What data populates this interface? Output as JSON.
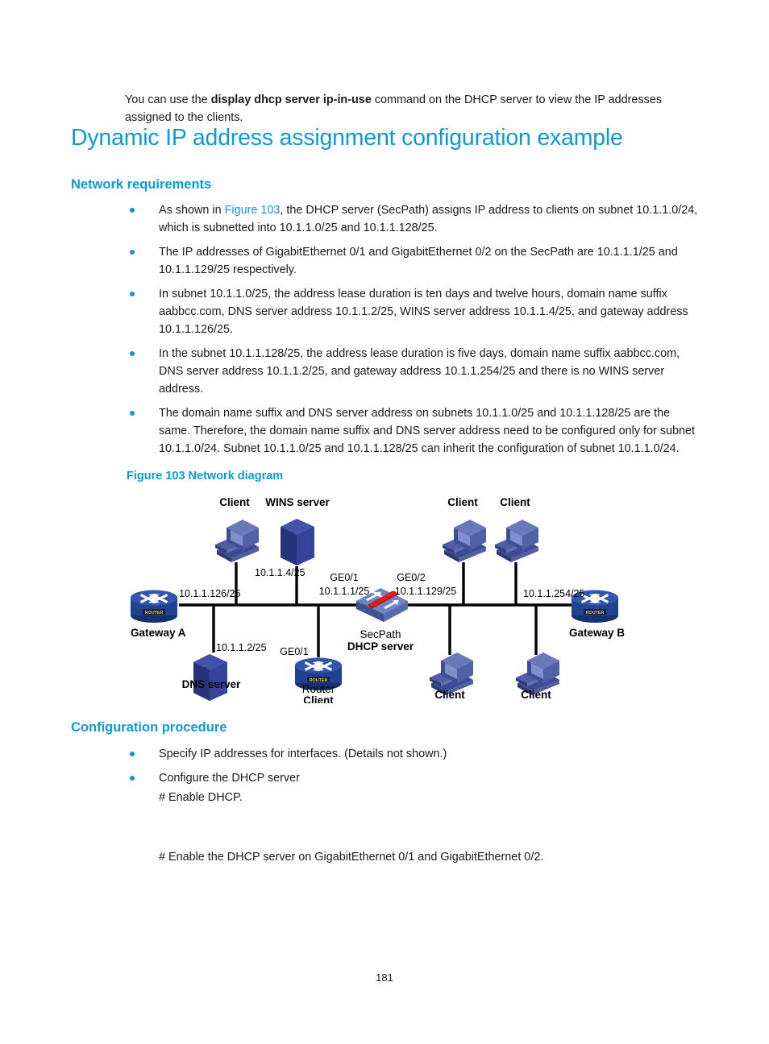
{
  "page": {
    "number": "181",
    "accent_color": "#0d9bd7",
    "bullet_color": "#1b8fd4"
  },
  "intro": {
    "before_bold": "You can use the ",
    "bold_command": "display dhcp server ip-in-use",
    "after_bold": " command on the DHCP server to view the IP addresses assigned to the clients."
  },
  "headings": {
    "h1": "Dynamic IP address assignment configuration example",
    "network_requirements": "Network requirements",
    "configuration_procedure": "Configuration procedure"
  },
  "requirements": [
    {
      "lead": "As shown in ",
      "link": "Figure 103",
      "rest": ", the DHCP server (SecPath) assigns IP address to clients on subnet 10.1.1.0/24, which is subnetted into 10.1.1.0/25 and 10.1.1.128/25."
    },
    {
      "lead": "",
      "link": "",
      "rest": "The IP addresses of GigabitEthernet 0/1 and GigabitEthernet 0/2 on the SecPath are 10.1.1.1/25 and 10.1.1.129/25 respectively."
    },
    {
      "lead": "",
      "link": "",
      "rest": "In subnet 10.1.1.0/25, the address lease duration is ten days and twelve hours, domain name suffix aabbcc.com, DNS server address 10.1.1.2/25, WINS server address 10.1.1.4/25, and gateway address 10.1.1.126/25."
    },
    {
      "lead": "",
      "link": "",
      "rest": "In the subnet 10.1.1.128/25, the address lease duration is five days, domain name suffix aabbcc.com, DNS server address 10.1.1.2/25, and gateway address 10.1.1.254/25 and there is no WINS server address."
    },
    {
      "lead": "",
      "link": "",
      "rest": "The domain name suffix and DNS server address on subnets 10.1.1.0/25 and 10.1.1.128/25 are the same. Therefore, the domain name suffix and DNS server address need to be configured only for subnet 10.1.1.0/24. Subnet 10.1.1.0/25 and 10.1.1.128/25 can inherit the configuration of subnet 10.1.1.0/24."
    }
  ],
  "figure": {
    "caption": "Figure 103 Network diagram",
    "nodes": {
      "gateway_a": "Gateway A",
      "gateway_b": "Gateway B",
      "wins_server": "WINS server",
      "dns_server": "DNS server",
      "secpath_line1": "SecPath",
      "secpath_line2": "DHCP server",
      "router_client_line1": "Router",
      "router_client_line2": "Client",
      "client_top_left": "Client",
      "client_top_right_1": "Client",
      "client_top_right_2": "Client",
      "client_bottom_1": "Client",
      "client_bottom_2": "Client",
      "router_badge": "ROUTER"
    },
    "labels": {
      "gateway_a_ip": "10.1.1.126/25",
      "wins_ip": "10.1.1.4/25",
      "dns_ip": "10.1.1.2/25",
      "ge01_name": "GE0/1",
      "ge01_ip": "10.1.1.1/25",
      "ge02_name": "GE0/2",
      "ge02_ip": "10.1.1.129/25",
      "gateway_b_ip": "10.1.1.254/25",
      "router_client_if": "GE0/1"
    }
  },
  "procedure": {
    "steps": [
      "Specify IP addresses for interfaces. (Details not shown.)",
      "Configure the DHCP server"
    ],
    "enable_dhcp": "# Enable DHCP.",
    "enable_ge": "# Enable the DHCP server on GigabitEthernet 0/1 and GigabitEthernet 0/2."
  }
}
